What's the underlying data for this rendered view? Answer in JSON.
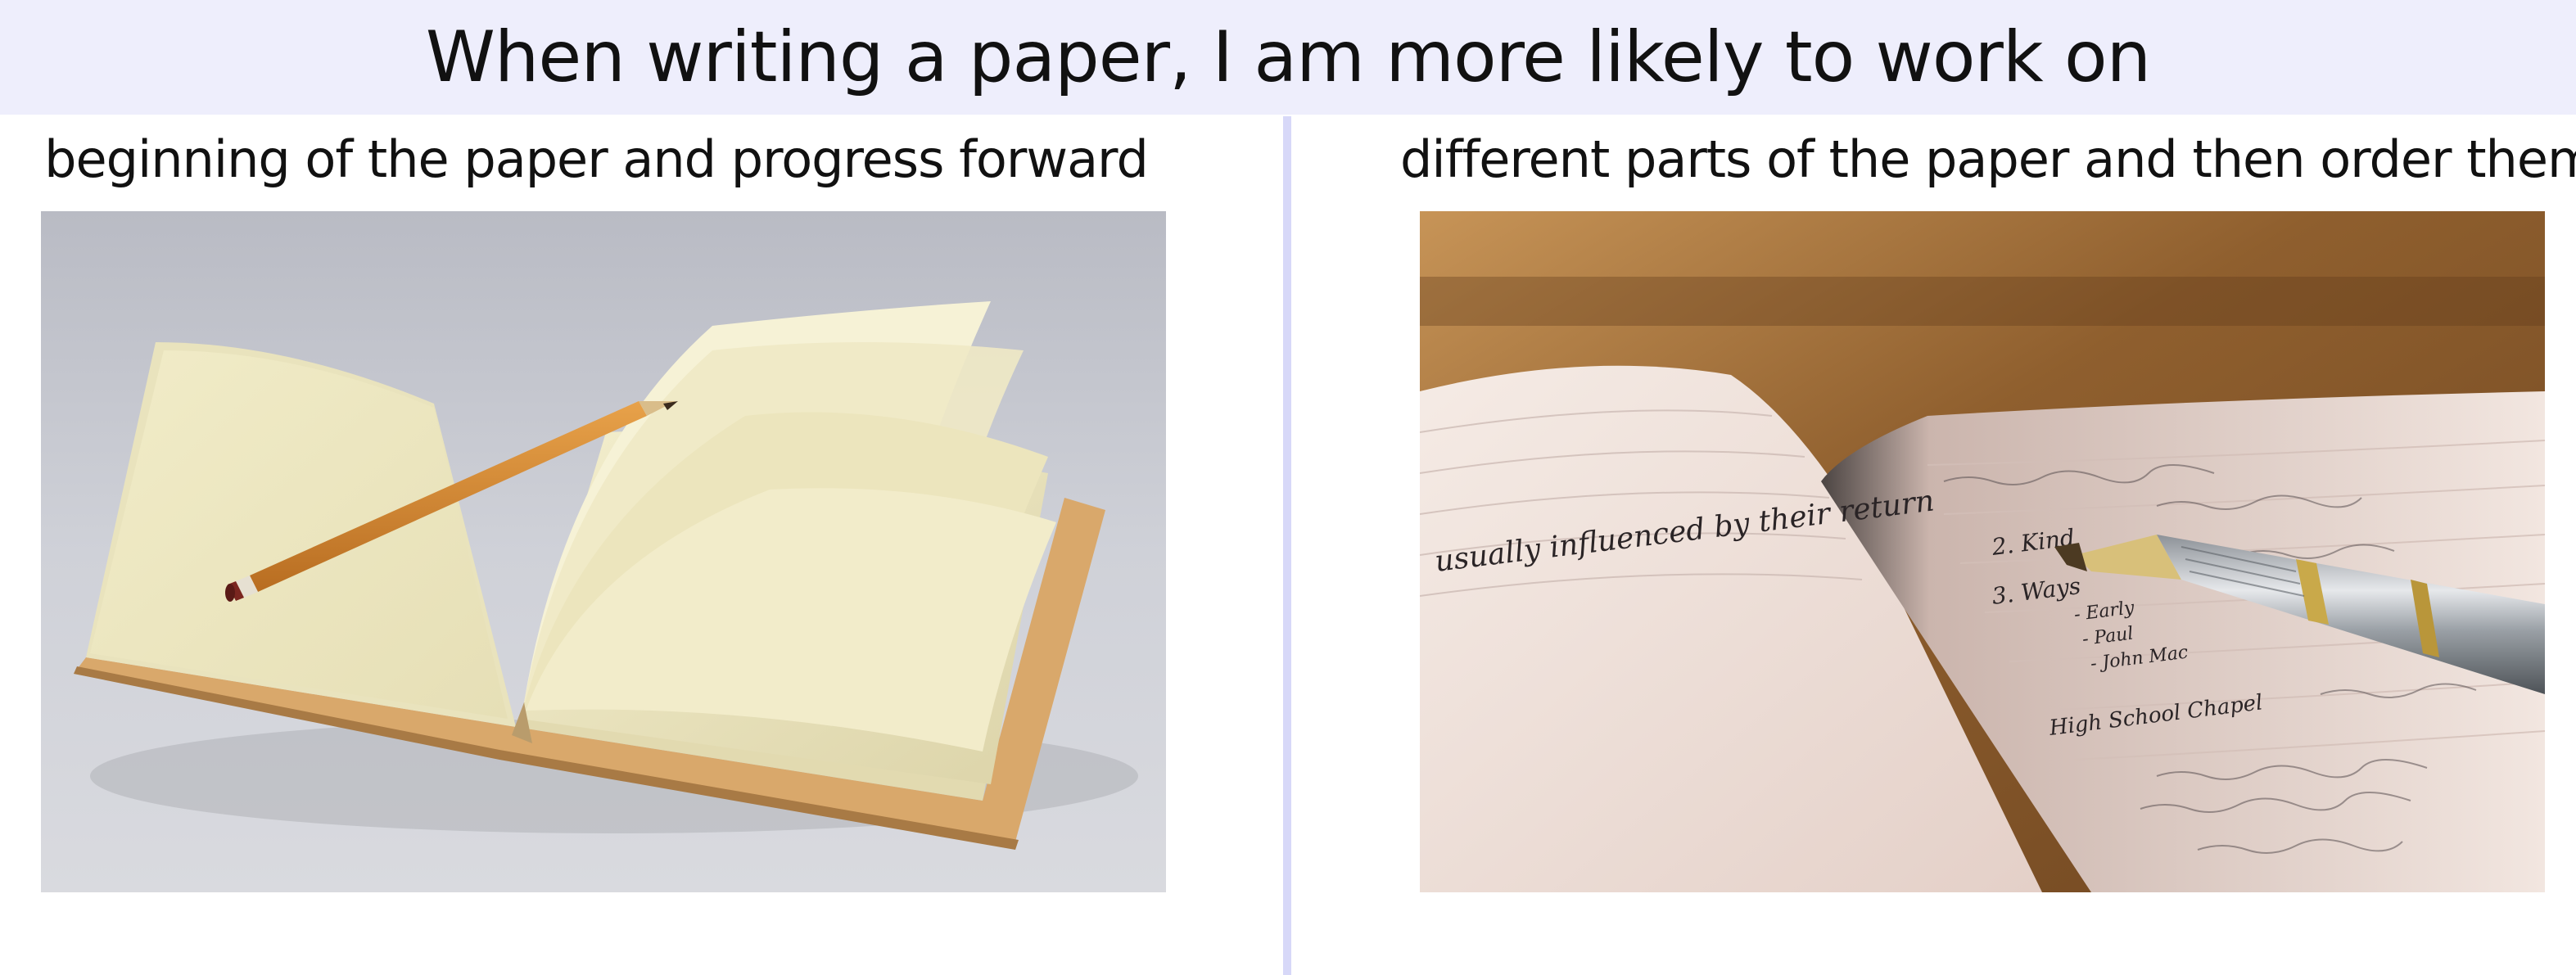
{
  "poll": {
    "question": "When writing a paper, I am more likely to work on",
    "options": [
      {
        "label": "beginning of the paper and progress forward",
        "image_icon": "open-notebook-with-pencil"
      },
      {
        "label": "different parts of the paper and then order them",
        "image_icon": "handwritten-notebook-with-fountain-pen",
        "handwriting": {
          "line1": "usually influenced by their return",
          "line2": "2. Kind",
          "line3": "3. Ways",
          "line4": "- Early",
          "line5": "- Paul",
          "line6": "- John Mac",
          "line7": "High School Chapel"
        }
      }
    ]
  },
  "colors": {
    "header_background": "#eeeefc",
    "divider": "#d7d8f8",
    "text": "#111111"
  }
}
